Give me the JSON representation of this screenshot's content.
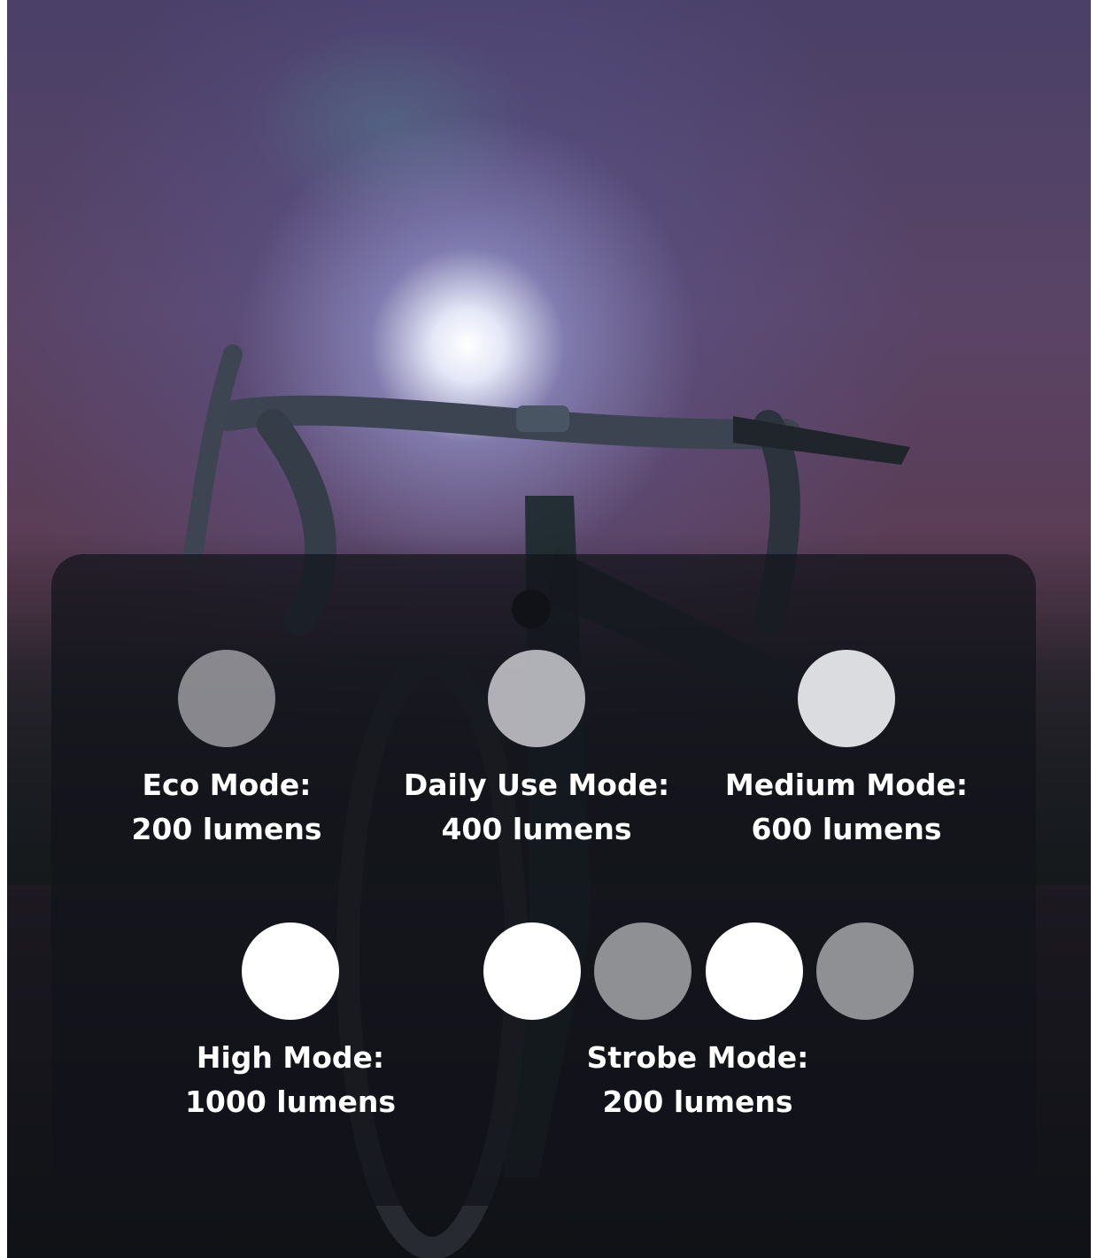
{
  "modes": [
    {
      "id": "eco",
      "name": "Eco Mode:",
      "value": "200 lumens"
    },
    {
      "id": "daily",
      "name": "Daily Use Mode:",
      "value": "400 lumens"
    },
    {
      "id": "medium",
      "name": "Medium Mode:",
      "value": "600 lumens"
    },
    {
      "id": "high",
      "name": "High Mode:",
      "value": "1000 lumens"
    },
    {
      "id": "strobe",
      "name": "Strobe Mode:",
      "value": "200 lumens"
    }
  ],
  "colors": {
    "panel": "#12141a",
    "text": "#ffffff",
    "light_on": "#ffffff",
    "light_dim": "#bec0c4"
  }
}
